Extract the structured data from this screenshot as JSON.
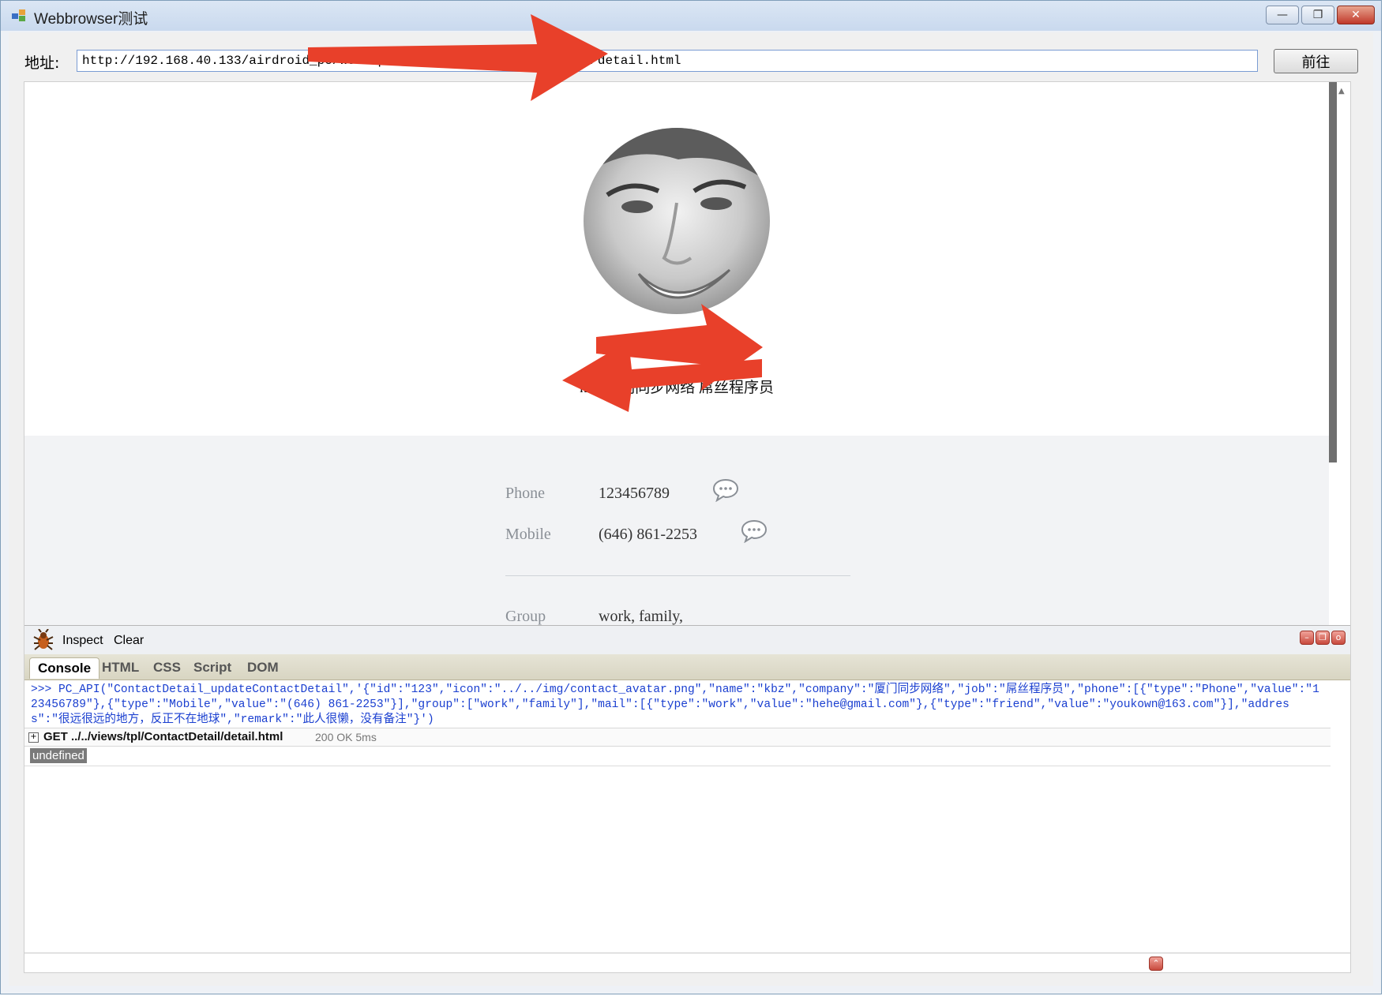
{
  "window": {
    "title": "Webbrowser测试",
    "buttons": {
      "minimize": "—",
      "maximize": "❐",
      "close": "✕"
    }
  },
  "address_bar": {
    "label": "地址:",
    "url": "http://192.168.40.133/airdroid_pc/workspace/views/tpl/ContactDetail/detail.html",
    "go_label": "前往"
  },
  "contact": {
    "avatar_icon": "avatar-photo",
    "name_company_job": "kbz 厦门同步网络 屌丝程序员",
    "fields": [
      {
        "label": "Phone",
        "value": "123456789",
        "action_icon": "message-icon"
      },
      {
        "label": "Mobile",
        "value": "(646) 861-2253",
        "action_icon": "message-icon"
      },
      {
        "label": "Group",
        "value": "work, family,"
      }
    ]
  },
  "firebug": {
    "tools": {
      "inspect": "Inspect",
      "clear": "Clear"
    },
    "tabs": [
      "Console",
      "HTML",
      "CSS",
      "Script",
      "DOM"
    ],
    "active_tab": "Console",
    "console": {
      "command": ">>> PC_API(\"ContactDetail_updateContactDetail\",'{\"id\":\"123\",\"icon\":\"../../img/contact_avatar.png\",\"name\":\"kbz\",\"company\":\"厦门同步网络\",\"job\":\"屌丝程序员\",\"phone\":[{\"type\":\"Phone\",\"value\":\"123456789\"},{\"type\":\"Mobile\",\"value\":\"(646) 861-2253\"}],\"group\":[\"work\",\"family\"],\"mail\":[{\"type\":\"work\",\"value\":\"hehe@gmail.com\"},{\"type\":\"friend\",\"value\":\"youkown@163.com\"}],\"address\":\"很远很远的地方，反正不在地球\",\"remark\":\"此人很懒，没有备注\"}')",
      "request": "GET ../../views/tpl/ContactDetail/detail.html",
      "request_status": "200 OK 5ms",
      "result": "undefined"
    }
  },
  "colors": {
    "annotation_arrow": "#e8402a",
    "console_text": "#1a3fd0",
    "title_bar": "#c9d9ee"
  }
}
